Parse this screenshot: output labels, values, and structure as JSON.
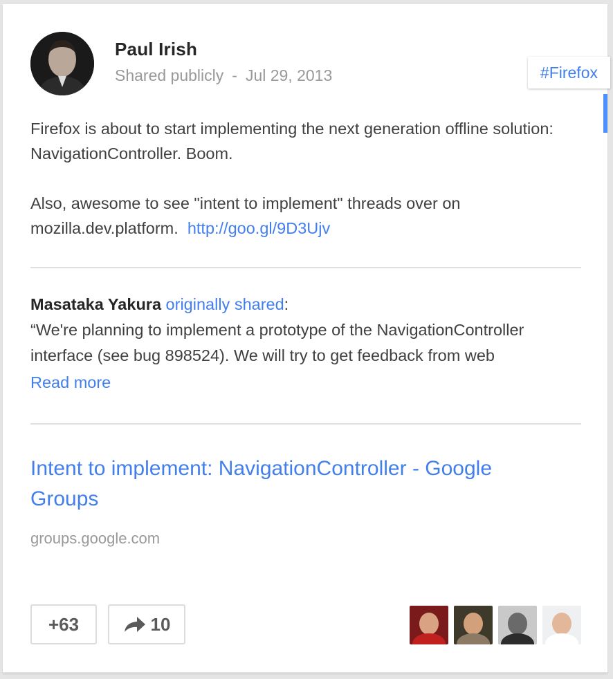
{
  "post": {
    "author": "Paul Irish",
    "visibility": "Shared publicly",
    "separator": "-",
    "date": "Jul 29, 2013",
    "hashtag": "#Firefox",
    "paragraph1": "Firefox is about to start implementing the next generation offline solution: NavigationController. Boom.",
    "paragraph2_text": "Also, awesome to see \"intent to implement\" threads over on mozilla.dev.platform.",
    "paragraph2_link": "http://goo.gl/9D3Ujv"
  },
  "reshare": {
    "original_author": "Masataka Yakura",
    "originally_shared_label": "originally shared",
    "colon": ":",
    "quote": "“We're planning to implement a prototype of the NavigationController interface (see bug 898524).  We will try to get feedback from web",
    "read_more": "Read more"
  },
  "link_preview": {
    "title": "Intent to implement: NavigationController - Google Groups",
    "domain": "groups.google.com"
  },
  "actions": {
    "plus_one": "+63",
    "shares": "10"
  },
  "plusers": [
    {
      "icon": "avatar-red-shirt"
    },
    {
      "icon": "avatar-curly-hair"
    },
    {
      "icon": "avatar-bw-photo"
    },
    {
      "icon": "avatar-light-shirt"
    }
  ],
  "colors": {
    "link": "#427fed",
    "meta_gray": "#999999",
    "text": "#404040",
    "accent_scrollbar": "#4d90fe"
  }
}
